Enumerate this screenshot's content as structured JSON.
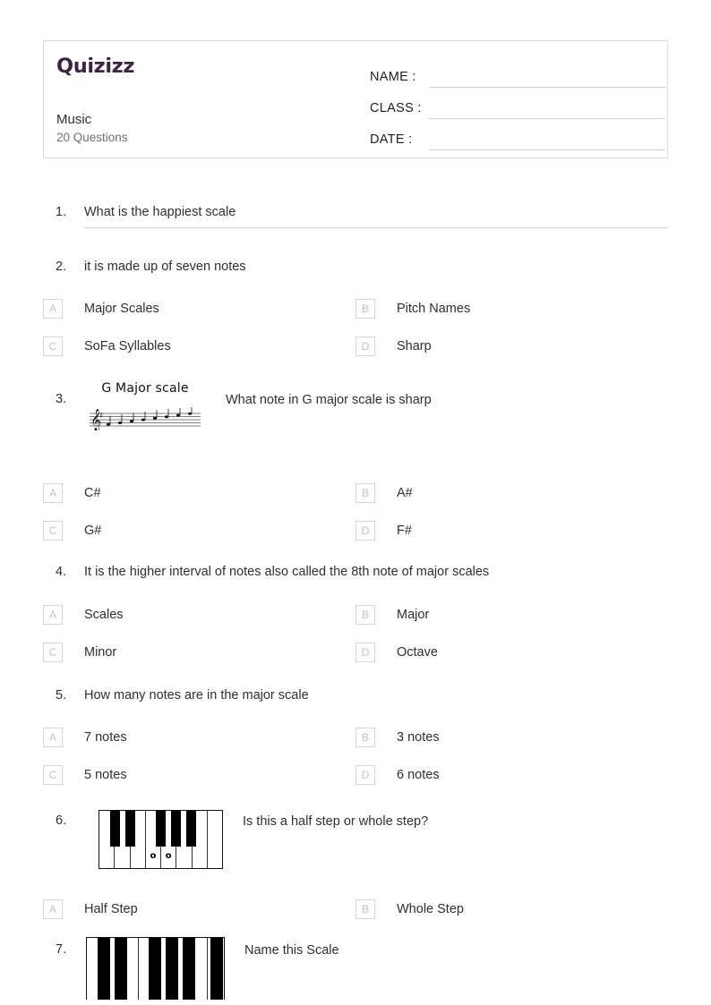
{
  "header": {
    "logo_text": "Quizizz",
    "logo_color": "#3b2342",
    "quiz_title": "Music",
    "question_count_label": "20 Questions",
    "fields": [
      {
        "label": "NAME :",
        "value": ""
      },
      {
        "label": "CLASS :",
        "value": ""
      },
      {
        "label": "DATE  :",
        "value": ""
      }
    ]
  },
  "questions": [
    {
      "number": "1.",
      "text": "What is the happiest scale",
      "type": "open-response",
      "options": []
    },
    {
      "number": "2.",
      "text": "it is made up of seven notes",
      "type": "multiple-choice",
      "options": [
        {
          "letter": "A",
          "text": "Major Scales"
        },
        {
          "letter": "B",
          "text": "Pitch Names"
        },
        {
          "letter": "C",
          "text": "SoFa Syllables"
        },
        {
          "letter": "D",
          "text": "Sharp"
        }
      ]
    },
    {
      "number": "3.",
      "text": "What note in G major scale is sharp",
      "type": "multiple-choice-with-image",
      "media": {
        "kind": "music-staff",
        "title": "G Major scale",
        "clef": "treble-clef",
        "key_signature": "one-sharp",
        "note_count": 8
      },
      "options": [
        {
          "letter": "A",
          "text": "C#"
        },
        {
          "letter": "B",
          "text": "A#"
        },
        {
          "letter": "C",
          "text": "G#"
        },
        {
          "letter": "D",
          "text": "F#"
        }
      ]
    },
    {
      "number": "4.",
      "text": "It is the higher interval of notes also called the 8th note of major scales",
      "type": "multiple-choice",
      "options": [
        {
          "letter": "A",
          "text": "Scales"
        },
        {
          "letter": "B",
          "text": "Major"
        },
        {
          "letter": "C",
          "text": "Minor"
        },
        {
          "letter": "D",
          "text": "Octave"
        }
      ]
    },
    {
      "number": "5.",
      "text": "How many notes are in the major scale",
      "type": "multiple-choice",
      "options": [
        {
          "letter": "A",
          "text": "7 notes"
        },
        {
          "letter": "B",
          "text": "3 notes"
        },
        {
          "letter": "C",
          "text": "5 notes"
        },
        {
          "letter": "D",
          "text": "6 notes"
        }
      ]
    },
    {
      "number": "6.",
      "text": "Is this a half step or whole step?",
      "type": "multiple-choice-with-image",
      "media": {
        "kind": "piano-keyboard",
        "white_key_count": 8,
        "marked_keys": [
          "o",
          "o"
        ],
        "marked_key_indices": [
          4,
          5
        ]
      },
      "options": [
        {
          "letter": "A",
          "text": "Half Step"
        },
        {
          "letter": "B",
          "text": "Whole Step"
        }
      ]
    },
    {
      "number": "7.",
      "text": "Name this Scale",
      "type": "multiple-choice-with-image",
      "media": {
        "kind": "piano-keyboard-zoomed",
        "white_key_count": 8
      },
      "options": []
    }
  ]
}
